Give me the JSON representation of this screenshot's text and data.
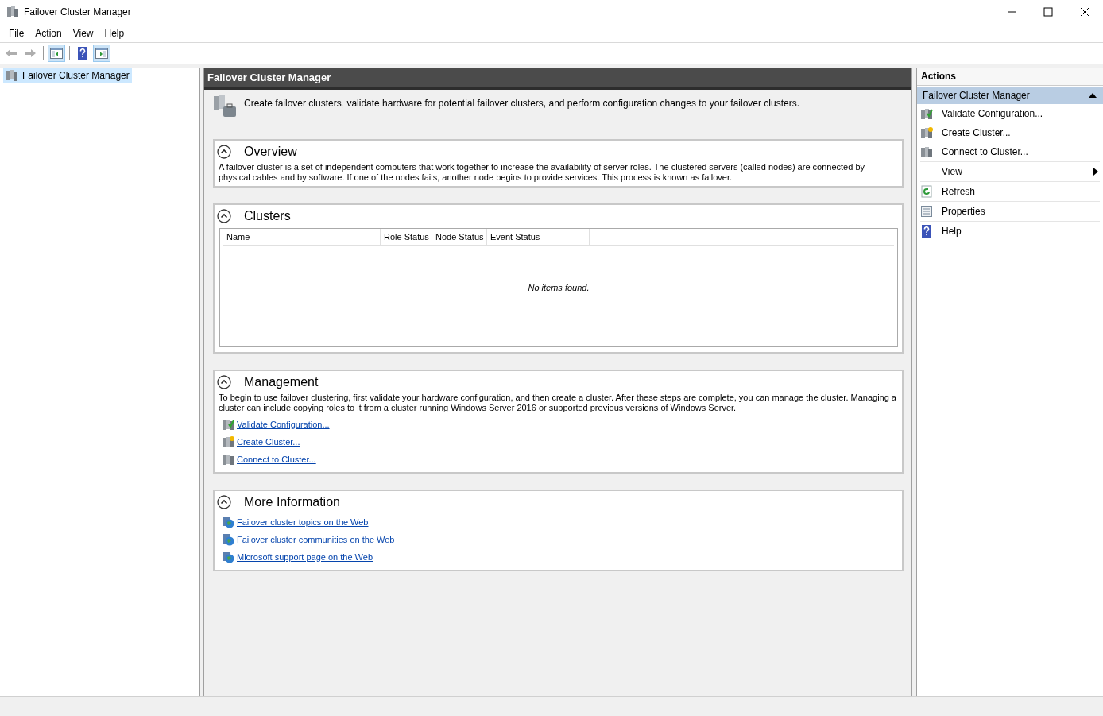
{
  "window": {
    "title": "Failover Cluster Manager"
  },
  "menu": [
    "File",
    "Action",
    "View",
    "Help"
  ],
  "toolbar": [
    {
      "kind": "back",
      "disabled": true,
      "pressed": false
    },
    {
      "kind": "forward",
      "disabled": true,
      "pressed": false
    },
    {
      "kind": "tree-pane",
      "disabled": false,
      "pressed": true
    },
    {
      "kind": "help",
      "disabled": false,
      "pressed": false
    },
    {
      "kind": "action-pane",
      "disabled": false,
      "pressed": true
    }
  ],
  "tree": [
    {
      "label": "Failover Cluster Manager",
      "selected": true
    }
  ],
  "content": {
    "header": "Failover Cluster Manager",
    "description": "Create failover clusters, validate hardware for potential failover clusters, and perform configuration changes to your failover clusters.",
    "sections": [
      {
        "title": "Overview",
        "expanded": true,
        "text": "A failover cluster is a set of independent computers that work together to increase the availability of server roles. The clustered servers (called nodes) are connected by physical cables and by software. If one of the nodes fails, another node begins to provide services. This process is known as failover."
      },
      {
        "title": "Clusters",
        "expanded": true,
        "table": {
          "columns": [
            "Name",
            "Role Status",
            "Node Status",
            "Event Status"
          ],
          "empty_message": "No items found."
        }
      },
      {
        "title": "Management",
        "expanded": true,
        "text": "To begin to use failover clustering, first validate your hardware configuration, and then create a cluster.  After these steps are complete, you can manage the cluster. Managing a cluster can include copying roles to it from a cluster running Windows Server 2016 or supported previous versions of Windows Server.",
        "links": [
          {
            "kind": "validate",
            "label": "Validate Configuration..."
          },
          {
            "kind": "create",
            "label": "Create Cluster..."
          },
          {
            "kind": "connect",
            "label": "Connect to Cluster..."
          }
        ]
      },
      {
        "title": "More Information",
        "expanded": true,
        "links": [
          {
            "kind": "web",
            "label": "Failover cluster topics on the Web"
          },
          {
            "kind": "web",
            "label": "Failover cluster communities on the Web"
          },
          {
            "kind": "web",
            "label": "Microsoft support page on the Web"
          }
        ]
      }
    ]
  },
  "actions": {
    "title": "Actions",
    "group": {
      "title": "Failover Cluster Manager",
      "expanded": true
    },
    "items": [
      {
        "kind": "validate",
        "label": "Validate Configuration..."
      },
      {
        "kind": "create",
        "label": "Create Cluster..."
      },
      {
        "kind": "connect",
        "label": "Connect to Cluster..."
      },
      {
        "kind": "submenu",
        "label": "View"
      },
      {
        "kind": "refresh",
        "label": "Refresh"
      },
      {
        "kind": "properties",
        "label": "Properties"
      },
      {
        "kind": "help",
        "label": "Help"
      }
    ]
  }
}
